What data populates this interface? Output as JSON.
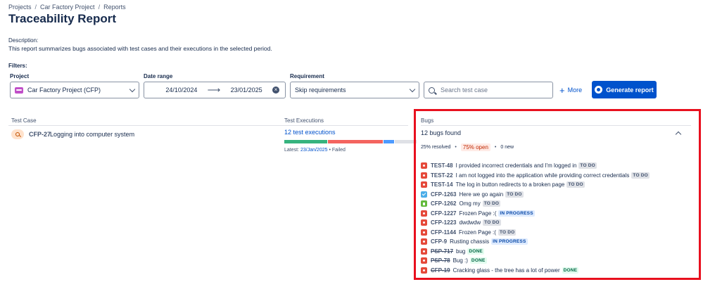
{
  "breadcrumb": [
    "Projects",
    "Car Factory Project",
    "Reports"
  ],
  "page_title": "Traceability Report",
  "description": {
    "label": "Description:",
    "text": "This report summarizes bugs associated with test cases and their executions in the selected period."
  },
  "filters": {
    "label": "Filters:",
    "project": {
      "label": "Project",
      "value": "Car Factory Project (CFP)"
    },
    "date_range": {
      "label": "Date range",
      "from": "24/10/2024",
      "to": "23/01/2025"
    },
    "requirement": {
      "label": "Requirement",
      "value": "Skip requirements"
    },
    "search": {
      "placeholder": "Search test case"
    },
    "more_label": "More",
    "generate_label": "Generate report"
  },
  "columns": {
    "test_case": "Test Case",
    "test_executions": "Test Executions",
    "bugs": "Bugs"
  },
  "row": {
    "test_case": {
      "key": "CFP-27",
      "summary": "Logging into computer system"
    },
    "executions": {
      "link": "12 test executions",
      "latest_label": "Latest:",
      "latest_date": "23/Jan/2025",
      "latest_status": "• Failed",
      "bar": [
        {
          "fraction": 0.33,
          "color": "#36b37e"
        },
        {
          "fraction": 0.42,
          "color": "#f4645f"
        },
        {
          "fraction": 0.08,
          "color": "#4c9aff"
        },
        {
          "fraction": 0.17,
          "color": "#dfe1e6"
        }
      ]
    },
    "bugs": {
      "found": "12 bugs found",
      "resolved": "25% resolved",
      "open": "75% open",
      "new": "0 new",
      "items": [
        {
          "key": "TEST-48",
          "summary": "I provided incorrect credentials and I'm logged in",
          "status": "TO DO",
          "type": "bug",
          "done": false
        },
        {
          "key": "TEST-22",
          "summary": "I am not logged into the application while providing correct credentials",
          "status": "TO DO",
          "type": "bug",
          "done": false
        },
        {
          "key": "TEST-14",
          "summary": "The log in button redirects to a broken page",
          "status": "TO DO",
          "type": "bug",
          "done": false
        },
        {
          "key": "CFP-1263",
          "summary": "Here we go again",
          "status": "TO DO",
          "type": "task",
          "done": false
        },
        {
          "key": "CFP-1262",
          "summary": "Omg my",
          "status": "TO DO",
          "type": "story",
          "done": false
        },
        {
          "key": "CFP-1227",
          "summary": "Frozen Page :(",
          "status": "IN PROGRESS",
          "type": "bug",
          "done": false
        },
        {
          "key": "CFP-1223",
          "summary": "dwdwdw",
          "status": "TO DO",
          "type": "bug",
          "done": false
        },
        {
          "key": "CFP-1144",
          "summary": "Frozen Page :(",
          "status": "TO DO",
          "type": "bug",
          "done": false
        },
        {
          "key": "CFP-9",
          "summary": "Rusting chassis",
          "status": "IN PROGRESS",
          "type": "bug",
          "done": false
        },
        {
          "key": "PSP-717",
          "summary": "bug",
          "status": "DONE",
          "type": "bug",
          "done": true
        },
        {
          "key": "PSP-78",
          "summary": "Bug :)",
          "status": "DONE",
          "type": "bug",
          "done": true
        },
        {
          "key": "CFP-19",
          "summary": "Cracking glass - the tree has a lot of power",
          "status": "DONE",
          "type": "bug",
          "done": true
        }
      ]
    }
  },
  "colors": {
    "primary": "#0052cc",
    "bug_icon": "#e5493a",
    "task_icon": "#4bade8",
    "story_icon": "#63ba3c",
    "status_todo_bg": "#dfe1e6",
    "status_todo_fg": "#42526e",
    "status_inprogress_bg": "#deebff",
    "status_inprogress_fg": "#0747a6",
    "status_done_bg": "#e3fcef",
    "status_done_fg": "#006644",
    "highlight": "#e8101e"
  }
}
